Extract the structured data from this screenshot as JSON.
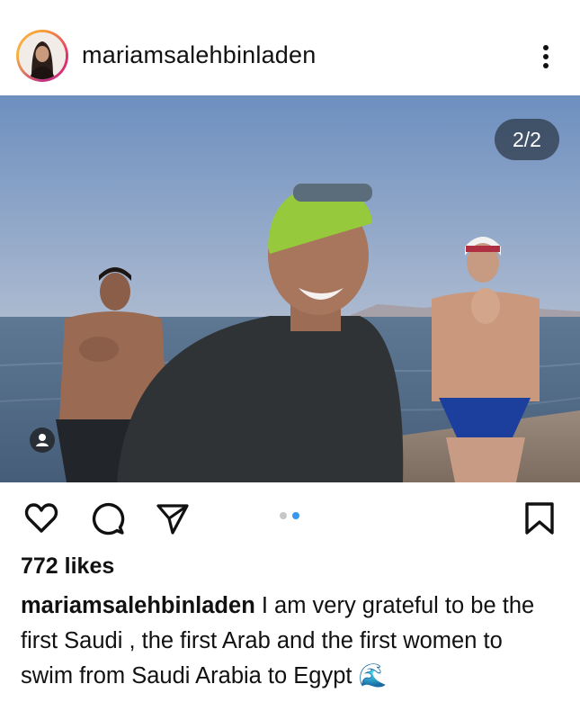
{
  "post": {
    "username": "mariamsalehbinladen",
    "image_counter": "2/2",
    "likes": "772 likes",
    "caption_text": "I am very grateful to be the first Saudi , the first Arab and the first women to swim from Saudi Arabia to Egypt",
    "caption_emoji": "🌊",
    "carousel": {
      "total": 2,
      "active_index": 1
    }
  },
  "icons": {
    "more": "more-vertical-icon",
    "like": "heart-icon",
    "comment": "comment-icon",
    "share": "send-icon",
    "save": "bookmark-icon",
    "tag": "person-tag-icon"
  },
  "colors": {
    "story_ring": "#e1306c",
    "dot_active": "#3897f0",
    "dot_inactive": "#c7c7c7",
    "text": "#111111"
  }
}
